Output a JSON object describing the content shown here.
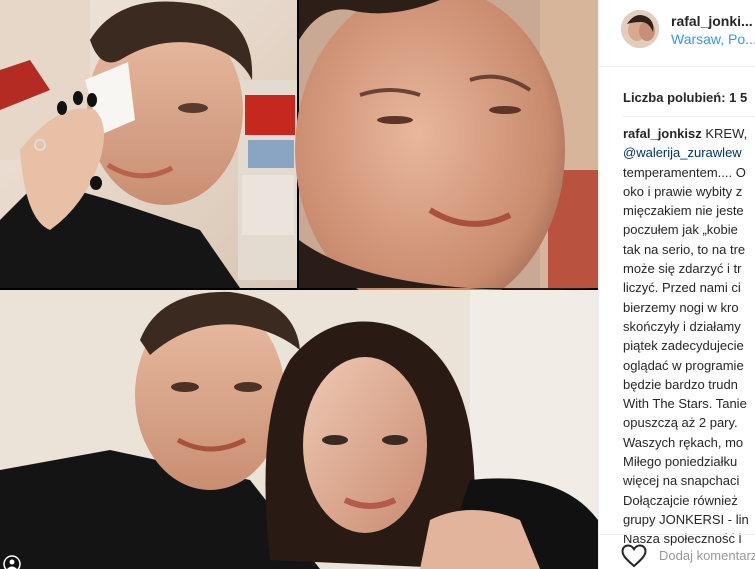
{
  "post": {
    "username": "rafal_jonki...",
    "location": "Warsaw, Po...",
    "likes_label": "Liczba polubień: 1 5",
    "avatar_icon": "avatar-photo",
    "corner_icon": "tagged-people-icon"
  },
  "caption": {
    "username": "rafal_jonkisz",
    "first_text": " KREW,",
    "mention": "@walerija_zurawlew",
    "lines": [
      "temperamentem.... O",
      "oko i prawie wybity z",
      "mięczakiem nie jeste",
      "poczułem jak „kobie",
      "tak na serio, to na tre",
      "może się zdarzyć i tr",
      "liczyć. Przed nami ci",
      "bierzemy nogi w kro",
      "skończyły i działamy",
      "piątek zadecydujecie",
      "oglądać w programie",
      "będzie bardzo trudn",
      "With The Stars. Tanie",
      "opuszczą aż 2 pary.",
      "Waszych rękach, mo",
      "Miłego poniedziałku",
      "więcej na snapchaci",
      "Dołączajcie również",
      "grupy JONKERSI - lin",
      "Nasza społeczność l"
    ]
  },
  "footer": {
    "like_icon": "heart-outline-icon",
    "comment_placeholder": "Dodaj komentarz..."
  },
  "colors": {
    "link": "#3897f0",
    "mention": "#003569",
    "text": "#262626",
    "border": "#efefef"
  }
}
